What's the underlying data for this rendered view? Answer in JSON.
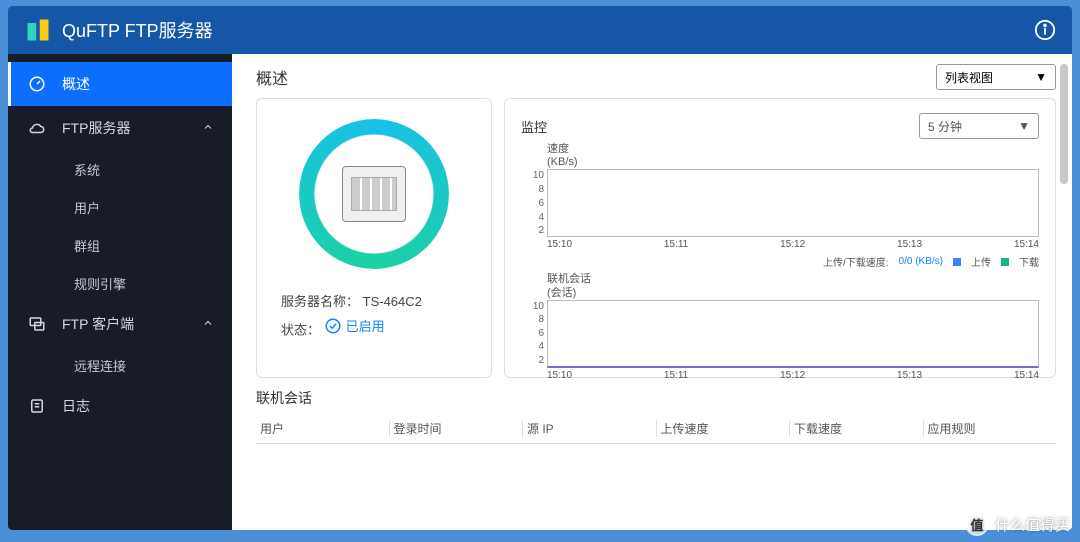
{
  "titlebar": {
    "title": "QuFTP FTP服务器"
  },
  "sidebar": {
    "overview": "概述",
    "ftp_server": "FTP服务器",
    "subs_server": [
      "系统",
      "用户",
      "群组",
      "规则引擎"
    ],
    "ftp_client": "FTP 客户端",
    "subs_client": [
      "远程连接"
    ],
    "log": "日志"
  },
  "main": {
    "heading": "概述",
    "view_dropdown": "列表视图",
    "server_name_label": "服务器名称：",
    "server_name": "TS-464C2",
    "status_label": "状态：",
    "status_value": "已启用",
    "monitor_label": "监控",
    "time_range": "5 分钟",
    "speed_label": "速度",
    "speed_unit": "(KB/s)",
    "sessions_label": "联机会话",
    "sessions_unit": "(会话)",
    "legend_text": "上传/下载速度:",
    "legend_rate": "0/0 (KB/s)",
    "legend_up": "上传",
    "legend_down": "下载",
    "table_title": "联机会话",
    "cols": [
      "用户",
      "登录时间",
      "源 IP",
      "上传速度",
      "下载速度",
      "应用规则"
    ]
  },
  "chart_data": [
    {
      "type": "line",
      "title": "速度 (KB/s)",
      "ylim": [
        0,
        10
      ],
      "y_ticks": [
        10,
        8,
        6,
        4,
        2
      ],
      "x_ticks": [
        "15:10",
        "15:11",
        "15:12",
        "15:13",
        "15:14"
      ],
      "series": [
        {
          "name": "上传",
          "color": "#3b82f6",
          "values": [
            0,
            0,
            0,
            0,
            0
          ]
        },
        {
          "name": "下载",
          "color": "#10b981",
          "values": [
            0,
            0,
            0,
            0,
            0
          ]
        }
      ]
    },
    {
      "type": "line",
      "title": "联机会话 (会话)",
      "ylim": [
        0,
        10
      ],
      "y_ticks": [
        10,
        8,
        6,
        4,
        2
      ],
      "x_ticks": [
        "15:10",
        "15:11",
        "15:12",
        "15:13",
        "15:14"
      ],
      "series": [
        {
          "name": "会话",
          "color": "#7b6bd4",
          "values": [
            0,
            0,
            0,
            0,
            0
          ]
        }
      ]
    }
  ],
  "watermark": "什么值得买"
}
